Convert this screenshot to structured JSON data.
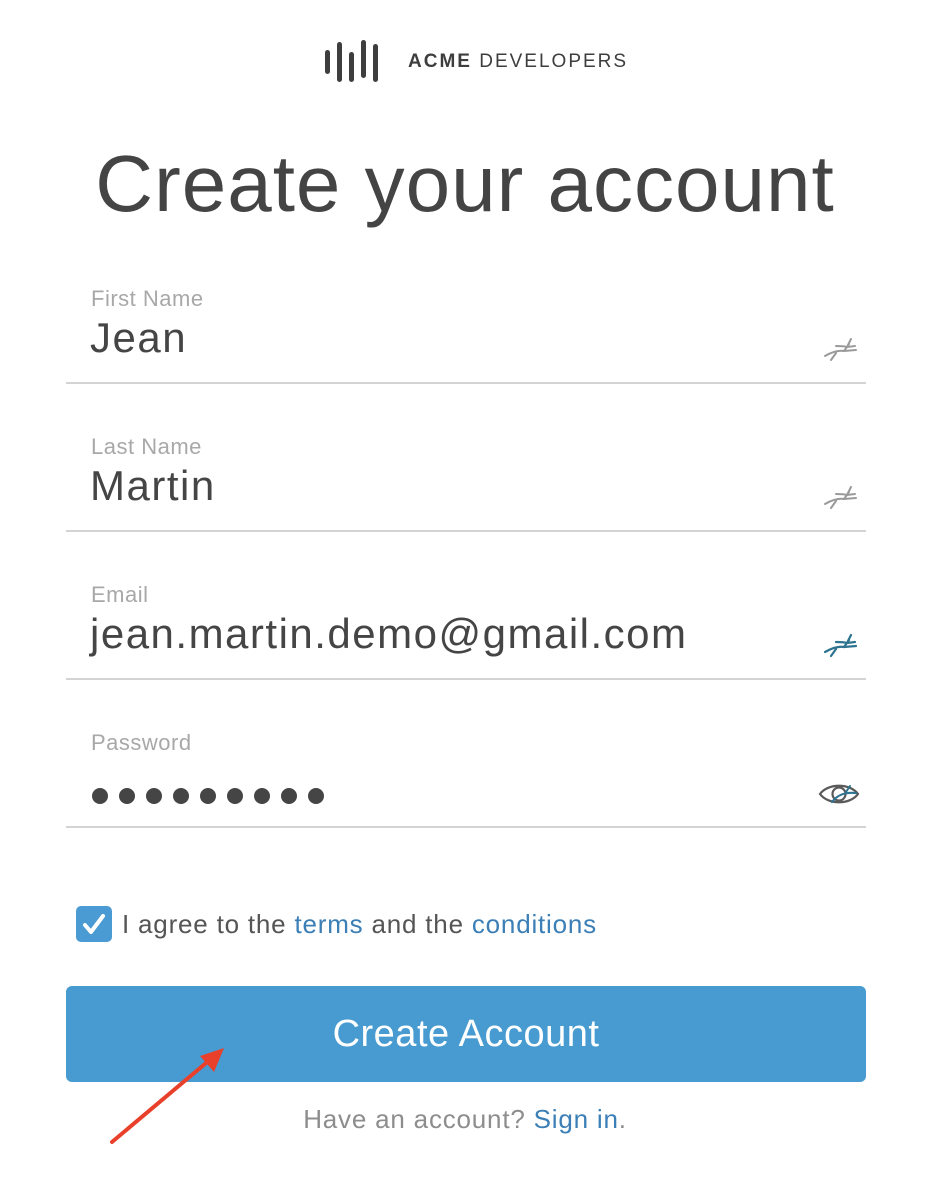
{
  "logo": {
    "brand": "ACME",
    "suffix": "DEVELOPERS"
  },
  "page_title": "Create your account",
  "fields": {
    "first_name": {
      "label": "First Name",
      "value": "Jean",
      "icon": "autofill-icon"
    },
    "last_name": {
      "label": "Last Name",
      "value": "Martin",
      "icon": "autofill-icon"
    },
    "email": {
      "label": "Email",
      "value": "jean.martin.demo@gmail.com",
      "icon": "autofill-icon"
    },
    "password": {
      "label": "Password",
      "masked_length": 9,
      "icon": "show-password-eye-icon"
    }
  },
  "agreement": {
    "checked": true,
    "prefix": "I agree to the",
    "terms_link": "terms",
    "middle": "and the",
    "conditions_link": "conditions"
  },
  "create_button_label": "Create Account",
  "signin": {
    "prompt": "Have an account?",
    "link": "Sign in",
    "suffix": "."
  },
  "colors": {
    "accent": "#479bd1",
    "link": "#3b7fb6",
    "annotation_arrow": "#e8402a"
  }
}
